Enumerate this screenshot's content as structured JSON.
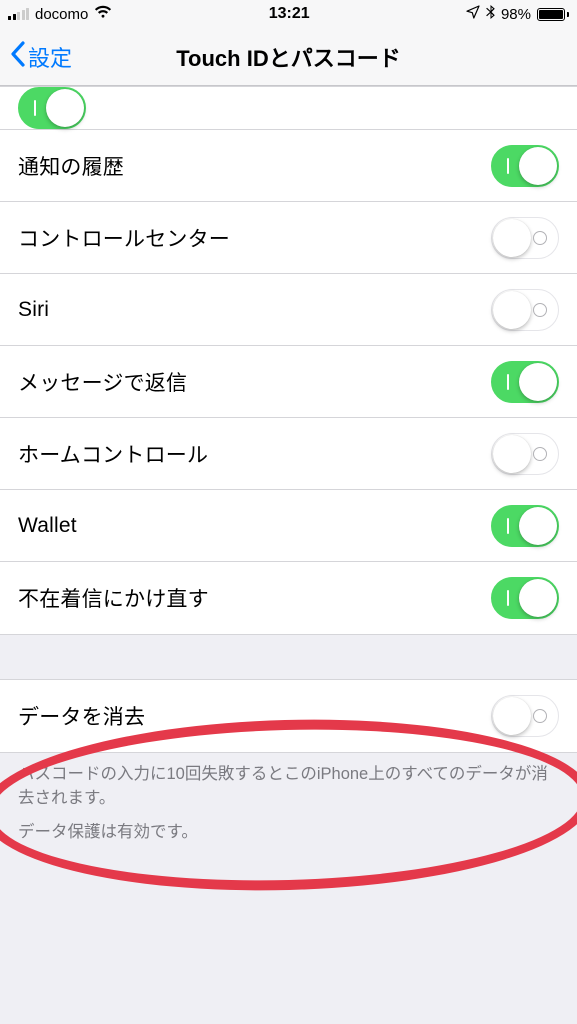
{
  "status": {
    "carrier": "docomo",
    "time": "13:21",
    "battery_percent": "98%",
    "battery_fill_pct": 98,
    "signal_active_bars": 2
  },
  "nav": {
    "back_label": "設定",
    "title": "Touch IDとパスコード"
  },
  "group1": {
    "rows": [
      {
        "label": "",
        "on": true
      },
      {
        "label": "通知の履歴",
        "on": true
      },
      {
        "label": "コントロールセンター",
        "on": false
      },
      {
        "label": "Siri",
        "on": false
      },
      {
        "label": "メッセージで返信",
        "on": true
      },
      {
        "label": "ホームコントロール",
        "on": false
      },
      {
        "label": "Wallet",
        "on": true
      },
      {
        "label": "不在着信にかけ直す",
        "on": true
      }
    ]
  },
  "group2": {
    "row": {
      "label": "データを消去",
      "on": false
    },
    "footer1": "パスコードの入力に10回失敗するとこのiPhone上のすべてのデータが消去されます。",
    "footer2": "データ保護は有効です。"
  }
}
